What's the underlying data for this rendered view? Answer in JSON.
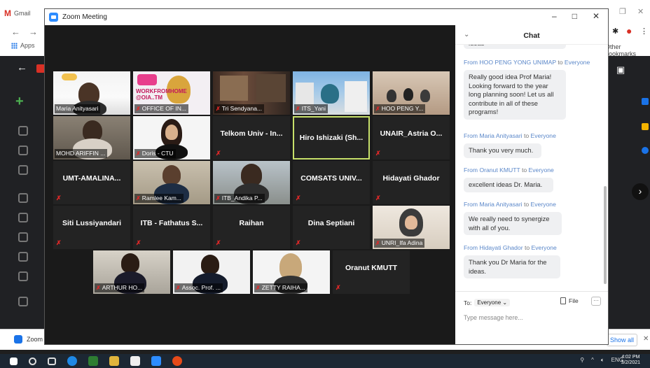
{
  "browser": {
    "tab_label": "Gmail",
    "apps_label": "Apps",
    "bookmarks_label": "Other bookmarks",
    "download_label": "Zoom",
    "show_all": "Show all"
  },
  "zoom": {
    "window_title": "Zoom Meeting",
    "minimize": "–",
    "maximize": "□",
    "close": "✕"
  },
  "participants": [
    {
      "name": "Maria Anityasari",
      "type": "video",
      "muted": false
    },
    {
      "name": "OFFICE OF IN...",
      "type": "video",
      "muted": true,
      "overlay_text": "WORKFROMHOME @OIA..TM"
    },
    {
      "name": "Tri Sendyana...",
      "type": "video",
      "muted": true
    },
    {
      "name": "ITS_Yani",
      "type": "video",
      "muted": true
    },
    {
      "name": "HOO PENG Y...",
      "type": "video",
      "muted": true
    },
    {
      "name": "MOHD ARIFFIN ...",
      "type": "video",
      "muted": false
    },
    {
      "name": "Doris - CTU",
      "type": "video",
      "muted": true
    },
    {
      "name": "Telkom Univ - In...",
      "type": "name",
      "muted": true
    },
    {
      "name": "Hiro Ishizaki (Sh...",
      "type": "name",
      "muted": false,
      "active": true
    },
    {
      "name": "UNAIR_Astria O...",
      "type": "name",
      "muted": true
    },
    {
      "name": "UMT-AMALINA...",
      "type": "name",
      "muted": true
    },
    {
      "name": "Ramlee Kam...",
      "type": "video",
      "muted": true
    },
    {
      "name": "ITB_Andika P...",
      "type": "video",
      "muted": true
    },
    {
      "name": "COMSATS UNIV...",
      "type": "name",
      "muted": true
    },
    {
      "name": "Hidayati Ghador",
      "type": "name",
      "muted": true
    },
    {
      "name": "Siti Lussiyandari",
      "type": "name",
      "muted": true
    },
    {
      "name": "ITB - Fathatus S...",
      "type": "name",
      "muted": true
    },
    {
      "name": "Raihan",
      "type": "name",
      "muted": true
    },
    {
      "name": "Dina Septiani",
      "type": "name",
      "muted": true
    },
    {
      "name": "UNRI_Ifa Adina",
      "type": "video",
      "muted": true
    },
    {
      "name": "ARTHUR HO...",
      "type": "video",
      "muted": true
    },
    {
      "name": "Assoc. Prof. ...",
      "type": "video",
      "muted": true
    },
    {
      "name": "ZETTY RAIHA...",
      "type": "video",
      "muted": true
    },
    {
      "name": "Oranut KMUTT",
      "type": "name",
      "muted": true
    }
  ],
  "chat": {
    "title": "Chat",
    "partial_top": "ideas",
    "from_word": "From",
    "to_word": "to",
    "messages": [
      {
        "from": "HOO PENG YONG UNIMAP",
        "to": "Everyone",
        "text": "Really good idea Prof Maria! Looking forward to the year long planning soon! Let us all contribute in all of these programs!"
      },
      {
        "from": "Maria Anityasari",
        "to": "Everyone",
        "text": "Thank you very much."
      },
      {
        "from": "Oranut KMUTT",
        "to": "Everyone",
        "text": "excellent ideas Dr. Maria."
      },
      {
        "from": "Maria Anityasari",
        "to": "Everyone",
        "text": "We really need to synergize with all of you."
      },
      {
        "from": "Hidayati Ghador",
        "to": "Everyone",
        "text": "Thank you Dr Maria for the ideas."
      }
    ],
    "to_label": "To:",
    "recipient": "Everyone",
    "file_label": "File",
    "more": "···",
    "placeholder": "Type message here..."
  },
  "taskbar": {
    "tray_lang": "ENG",
    "time": "4:02 PM",
    "date": "3/2/2021"
  }
}
